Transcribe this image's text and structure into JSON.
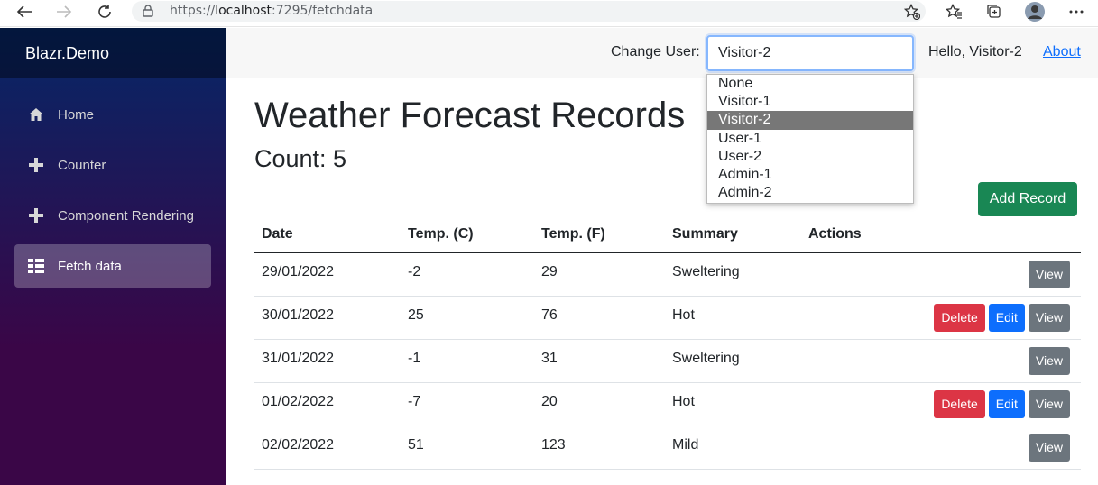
{
  "browser": {
    "url_scheme": "https://",
    "url_host": "localhost",
    "url_rest": ":7295/fetchdata"
  },
  "sidebar": {
    "brand": "Blazr.Demo",
    "items": [
      {
        "label": "Home",
        "icon": "home-icon"
      },
      {
        "label": "Counter",
        "icon": "plus-icon"
      },
      {
        "label": "Component Rendering",
        "icon": "plus-icon"
      },
      {
        "label": "Fetch data",
        "icon": "list-icon",
        "active": true
      }
    ]
  },
  "topbar": {
    "change_user_label": "Change User:",
    "selected_user": "Visitor-2",
    "hello": "Hello, Visitor-2",
    "about": "About"
  },
  "dropdown": {
    "options": [
      "None",
      "Visitor-1",
      "Visitor-2",
      "User-1",
      "User-2",
      "Admin-1",
      "Admin-2"
    ],
    "selected": "Visitor-2"
  },
  "main": {
    "title": "Weather Forecast Records",
    "count": "Count: 5",
    "add_button": "Add Record",
    "columns": [
      "Date",
      "Temp. (C)",
      "Temp. (F)",
      "Summary",
      "Actions"
    ],
    "rows": [
      {
        "date": "29/01/2022",
        "c": "-2",
        "f": "29",
        "summary": "Sweltering",
        "actions": [
          "View"
        ]
      },
      {
        "date": "30/01/2022",
        "c": "25",
        "f": "76",
        "summary": "Hot",
        "actions": [
          "Delete",
          "Edit",
          "View"
        ]
      },
      {
        "date": "31/01/2022",
        "c": "-1",
        "f": "31",
        "summary": "Sweltering",
        "actions": [
          "View"
        ]
      },
      {
        "date": "01/02/2022",
        "c": "-7",
        "f": "20",
        "summary": "Hot",
        "actions": [
          "Delete",
          "Edit",
          "View"
        ]
      },
      {
        "date": "02/02/2022",
        "c": "51",
        "f": "123",
        "summary": "Mild",
        "actions": [
          "View"
        ]
      }
    ]
  }
}
